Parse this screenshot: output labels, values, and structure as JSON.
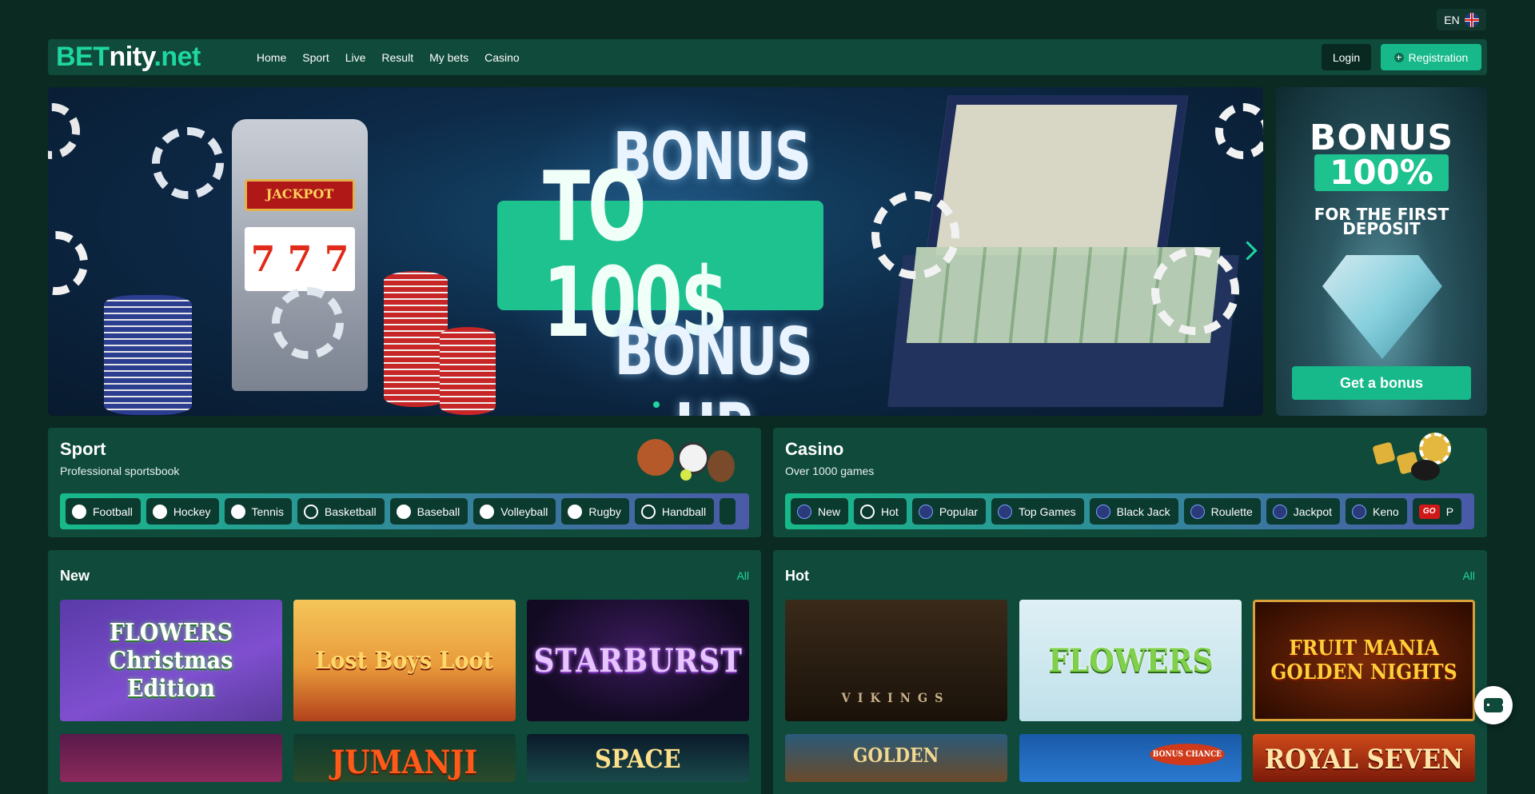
{
  "lang": {
    "code": "EN",
    "flag_icon": "uk-flag-icon"
  },
  "header": {
    "logo_part1": "BET",
    "logo_part2": "nity",
    "logo_part3": ".net",
    "nav": [
      "Home",
      "Sport",
      "Live",
      "Result",
      "My bets",
      "Casino"
    ],
    "login_label": "Login",
    "register_label": "Registration"
  },
  "hero": {
    "line1": "BONUS UP",
    "line2": "TO 100$",
    "line3": "BONUS UP",
    "slot_sign": "JACKPOT",
    "reel_symbol": "7"
  },
  "side_banner": {
    "title": "BONUS",
    "percent": "100%",
    "subtitle_1": "FOR THE FIRST",
    "subtitle_2": "DEPOSIT",
    "button_label": "Get a bonus"
  },
  "sport": {
    "title": "Sport",
    "subtitle": "Professional sportsbook",
    "tabs": [
      {
        "label": "Football",
        "icon": "football-icon"
      },
      {
        "label": "Hockey",
        "icon": "hockey-icon"
      },
      {
        "label": "Tennis",
        "icon": "tennis-icon"
      },
      {
        "label": "Basketball",
        "icon": "basketball-icon"
      },
      {
        "label": "Baseball",
        "icon": "baseball-icon"
      },
      {
        "label": "Volleyball",
        "icon": "volleyball-icon"
      },
      {
        "label": "Rugby",
        "icon": "rugby-icon"
      },
      {
        "label": "Handball",
        "icon": "handball-icon"
      }
    ]
  },
  "casino": {
    "title": "Casino",
    "subtitle": "Over 1000 games",
    "tabs": [
      {
        "label": "New",
        "icon": "new-icon"
      },
      {
        "label": "Hot",
        "icon": "fire-icon"
      },
      {
        "label": "Popular",
        "icon": "popular-icon"
      },
      {
        "label": "Top Games",
        "icon": "grid-icon"
      },
      {
        "label": "Black Jack",
        "icon": "card-icon"
      },
      {
        "label": "Roulette",
        "icon": "roulette-icon"
      },
      {
        "label": "Jackpot",
        "icon": "jackpot-icon"
      },
      {
        "label": "Keno",
        "icon": "keno-icon"
      },
      {
        "label": "P",
        "icon": "go-icon",
        "icon_text": "GO"
      }
    ]
  },
  "new_section": {
    "title": "New",
    "all_label": "All",
    "games": [
      "FLOWERS Christmas Edition",
      "Lost Boys Loot",
      "STARBURST",
      "",
      "JUMANJI",
      "SPACE"
    ]
  },
  "hot_section": {
    "title": "Hot",
    "all_label": "All",
    "games": [
      "VIKINGS",
      "FLOWERS",
      "FRUIT MANIA GOLDEN NIGHTS",
      "GOLDEN",
      "BONUS CHANCE",
      "ROYAL SEVEN"
    ]
  },
  "colors": {
    "background": "#0a2a22",
    "panel": "#0f4a3a",
    "accent": "#1ed6a0",
    "button": "#17b98a"
  }
}
